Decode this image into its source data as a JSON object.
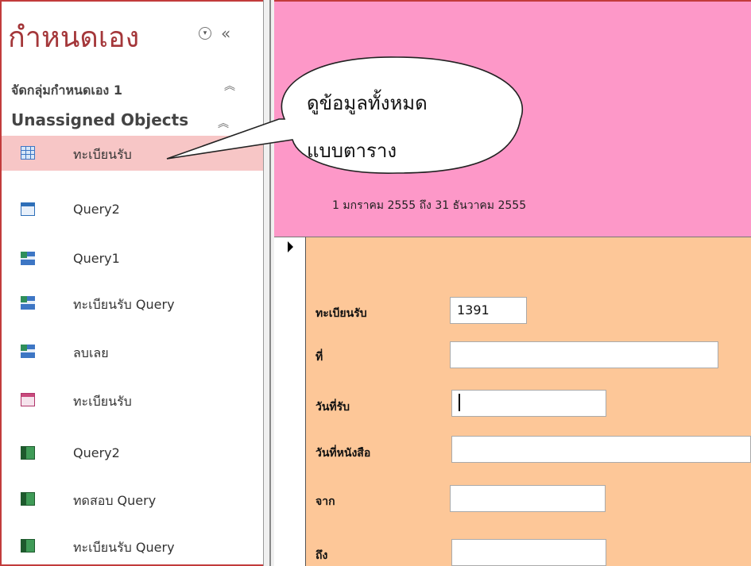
{
  "nav": {
    "title": "กำหนดเอง",
    "menu_icon": "dropdown-circle-icon",
    "collapse_icon": "double-chevron-left-icon",
    "groups": [
      {
        "label": "จัดกลุ่มกำหนดเอง 1",
        "chevron": "⌃⌃"
      },
      {
        "label": "Unassigned Objects",
        "chevron": "⌃⌃"
      }
    ],
    "items": [
      {
        "label": "ทะเบียนรับ",
        "type": "table",
        "selected": true
      },
      {
        "label": "Query2",
        "type": "query"
      },
      {
        "label": "Query1",
        "type": "query"
      },
      {
        "label": "ทะเบียนรับ Query",
        "type": "query"
      },
      {
        "label": "ลบเลย",
        "type": "query"
      },
      {
        "label": "ทะเบียนรับ",
        "type": "form"
      },
      {
        "label": "Query2",
        "type": "report"
      },
      {
        "label": "ทดสอบ Query",
        "type": "report"
      },
      {
        "label": "ทะเบียนรับ Query",
        "type": "report"
      }
    ]
  },
  "callout": {
    "line1": "ดูข้อมูลทั้งหมด",
    "line2": "แบบตาราง"
  },
  "form": {
    "date_range": "1 มกราคม 2555 ถึง 31 ธันวาคม 2555",
    "fields": [
      {
        "label": "ทะเบียนรับ",
        "value": "1391"
      },
      {
        "label": "ที่",
        "value": ""
      },
      {
        "label": "วันที่รับ",
        "value": ""
      },
      {
        "label": "วันที่หนังสือ",
        "value": ""
      },
      {
        "label": "จาก",
        "value": ""
      },
      {
        "label": "ถึง",
        "value": ""
      }
    ]
  },
  "colors": {
    "nav_title": "#a4373a",
    "selected_item": "#f7c6c6",
    "form_header": "#fd98c8",
    "form_detail": "#fdc798"
  }
}
